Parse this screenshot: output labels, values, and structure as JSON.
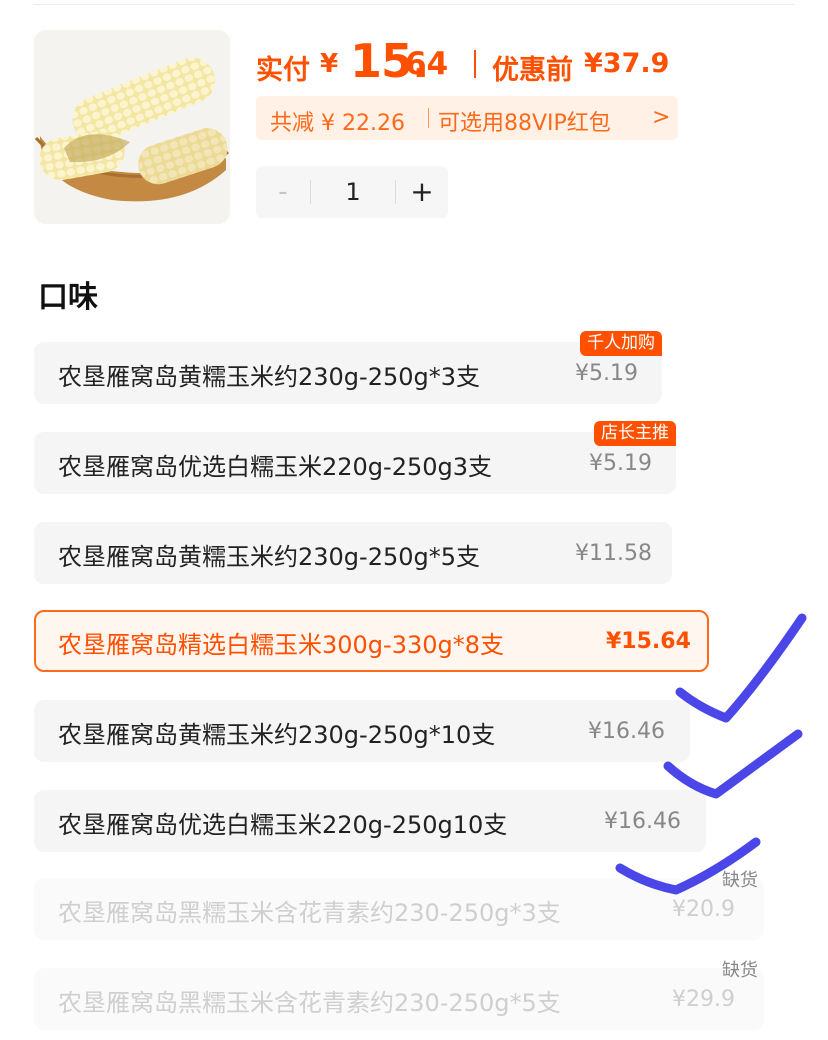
{
  "product": {
    "pay_label": "实付",
    "currency": "¥",
    "pay_int": "15.",
    "pay_dec": "64",
    "orig_label": "优惠前",
    "orig_price": "¥37.9"
  },
  "discount": {
    "total": "共减 ¥ 22.26",
    "vip": "可选用88VIP红包",
    "chevron": ">"
  },
  "quantity": {
    "minus": "-",
    "value": "1",
    "plus": "+"
  },
  "flavor_title": "口味",
  "options": [
    {
      "name": "农垦雁窝岛黄糯玉米约230g-250g*3支",
      "price": "¥5.19",
      "tag": "千人加购"
    },
    {
      "name": "农垦雁窝岛优选白糯玉米220g-250g3支",
      "price": "¥5.19",
      "tag": "店长主推"
    },
    {
      "name": "农垦雁窝岛黄糯玉米约230g-250g*5支",
      "price": "¥11.58"
    },
    {
      "name": "农垦雁窝岛精选白糯玉米300g-330g*8支",
      "price": "¥15.64",
      "selected": true
    },
    {
      "name": "农垦雁窝岛黄糯玉米约230g-250g*10支",
      "price": "¥16.46"
    },
    {
      "name": "农垦雁窝岛优选白糯玉米220g-250g10支",
      "price": "¥16.46"
    },
    {
      "name": "农垦雁窝岛黑糯玉米含花青素约230-250g*3支",
      "price": "¥20.9",
      "status": "缺货"
    },
    {
      "name": "农垦雁窝岛黑糯玉米含花青素约230-250g*5支",
      "price": "¥29.9",
      "status": "缺货"
    }
  ],
  "colors": {
    "accent": "#ff5000",
    "chip_bg": "#f5f5f5",
    "selected_bg": "#fff6f0",
    "annotation_ink": "#4a46e8"
  }
}
